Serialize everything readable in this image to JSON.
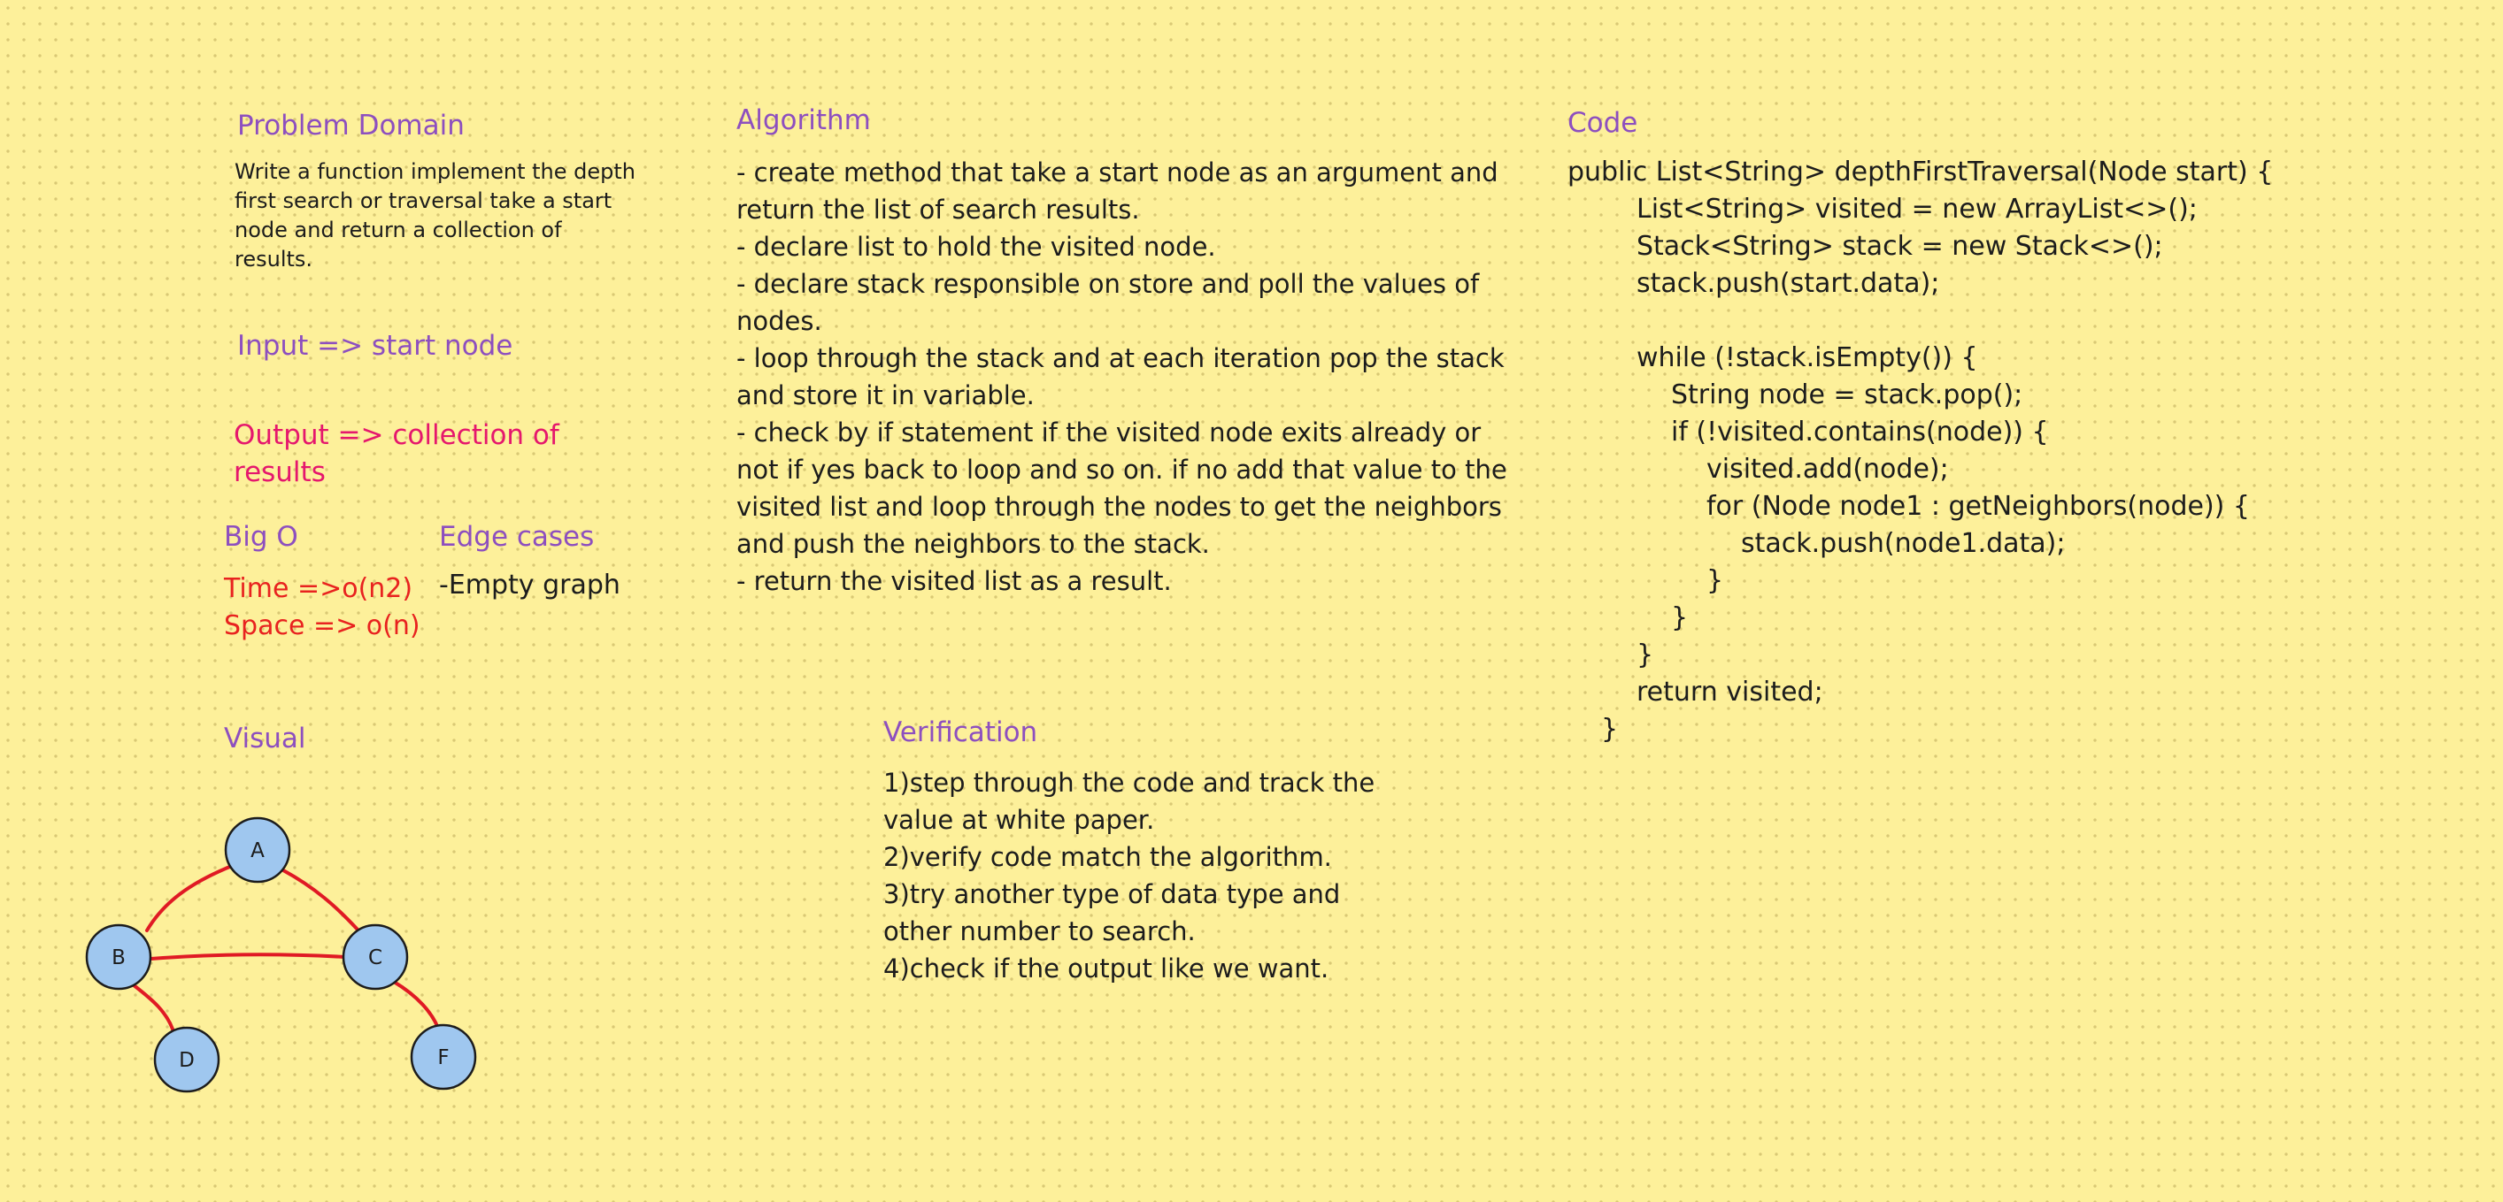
{
  "problem": {
    "heading": "Problem Domain",
    "description": "Write a function implement the depth\nfirst search or traversal take a start\nnode and return a collection of results."
  },
  "input": {
    "text": "Input => start node"
  },
  "output": {
    "text": "Output => collection of\nresults"
  },
  "big_o": {
    "heading": "Big O",
    "time": "Time =>o(n2)",
    "space": "Space => o(n)"
  },
  "edge_cases": {
    "heading": "Edge cases",
    "text": "-Empty graph"
  },
  "algorithm": {
    "heading": "Algorithm",
    "text": "- create method that take a start node as an argument and\nreturn the list of search results.\n- declare list to hold the visited node.\n- declare stack responsible on store and poll the values of\nnodes.\n- loop through the stack and at each iteration pop the stack\nand store it in variable.\n- check by if statement if the visited node exits already or\nnot if yes back to loop and so on. if no add that value to the\nvisited list and loop through the nodes to get the neighbors\nand push the neighbors to the stack.\n- return the visited list as a result."
  },
  "code": {
    "heading": "Code",
    "lines": [
      "public List<String> depthFirstTraversal(Node start) {",
      "List<String> visited = new ArrayList<>();",
      "Stack<String> stack = new Stack<>();",
      "stack.push(start.data);",
      "",
      "while (!stack.isEmpty()) {",
      "String node = stack.pop();",
      "if (!visited.contains(node)) {",
      "visited.add(node);",
      "for (Node node1 : getNeighbors(node)) {",
      "stack.push(node1.data);",
      "}",
      "}",
      "}",
      "return visited;",
      "}"
    ]
  },
  "visual": {
    "heading": "Visual",
    "nodes": [
      "A",
      "B",
      "C",
      "D",
      "F"
    ],
    "edges": [
      [
        "A",
        "B"
      ],
      [
        "A",
        "C"
      ],
      [
        "B",
        "C"
      ],
      [
        "B",
        "D"
      ],
      [
        "C",
        "F"
      ]
    ],
    "colors": {
      "node_fill": "#9fc7ef",
      "node_stroke": "#1c1c1c",
      "edge": "#e01a24"
    }
  },
  "verification": {
    "heading": "Verification",
    "text": "1)step through the code and track the\nvalue at white paper.\n2)verify code match the algorithm.\n3)try another type of data type and\nother number to search.\n4)check if the output like we want."
  },
  "colors": {
    "background": "#fdf09a",
    "heading": "#8d4fbf",
    "output": "#e5176d",
    "complexity": "#e8221f"
  }
}
